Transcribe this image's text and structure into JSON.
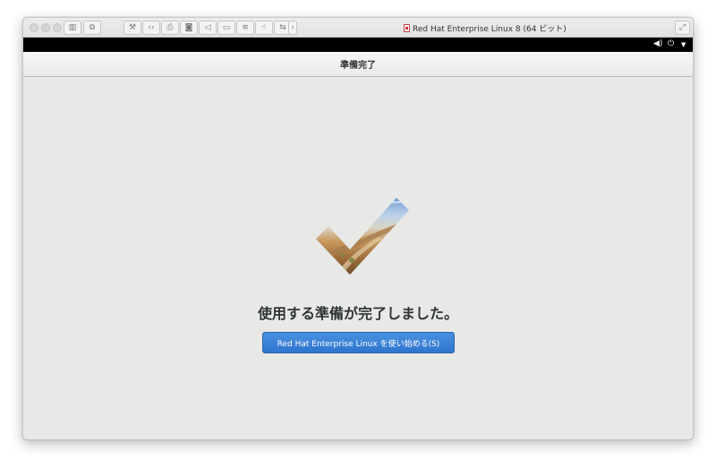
{
  "window": {
    "title": "Red Hat Enterprise Linux 8 (64 ビット)"
  },
  "toolbar": {
    "icons": [
      "sidebar-icon",
      "snapshot-icon",
      "settings-icon",
      "code-icon",
      "printer-icon",
      "disk-icon",
      "audio-icon",
      "camera-icon",
      "storage-icon",
      "usb-icon",
      "share-icon",
      "back-icon"
    ]
  },
  "system_bar": {
    "icons": [
      "volume-icon",
      "power-icon",
      "dropdown-icon"
    ]
  },
  "header": {
    "title": "準備完了"
  },
  "main": {
    "message": "使用する準備が完了しました。",
    "start_button_label": "Red Hat Enterprise Linux を使い始める(S)"
  },
  "colors": {
    "accent": "#3580d8",
    "background": "#e8e8e7",
    "text": "#2e3436"
  }
}
